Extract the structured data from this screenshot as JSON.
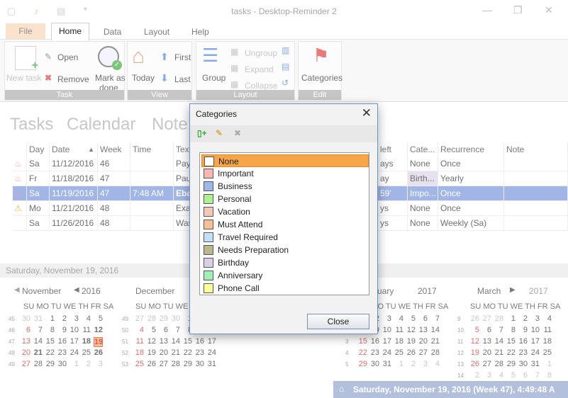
{
  "window": {
    "title": "tasks - Desktop-Reminder 2"
  },
  "menu": {
    "file": "File",
    "home": "Home",
    "data": "Data",
    "layout": "Layout",
    "help": "Help"
  },
  "ribbon": {
    "task": {
      "label": "Task",
      "new_task": "New task",
      "open": "Open",
      "remove": "Remove",
      "mark_done_1": "Mark as",
      "mark_done_2": "done"
    },
    "view": {
      "label": "View",
      "today": "Today",
      "first": "First",
      "last": "Last"
    },
    "layout": {
      "label": "Layout",
      "group": "Group",
      "ungroup": "Ungroup",
      "expand": "Expand",
      "collapse": "Collapse"
    },
    "edit": {
      "label": "Edit",
      "categories": "Categories"
    }
  },
  "views": {
    "tasks": "Tasks",
    "calendar": "Calendar",
    "notes": "Note"
  },
  "grid": {
    "headers": {
      "day": "Day",
      "date": "Date",
      "week": "Week",
      "time": "Time",
      "text": "Tex",
      "left": "left",
      "category": "Cate...",
      "recurrence": "Recurrence",
      "note": "Note"
    },
    "rows": [
      {
        "day": "Sa",
        "date": "11/12/2016",
        "week": "46",
        "time": "",
        "text": "Pay",
        "left": "ays",
        "category": "None",
        "recurrence": "Once"
      },
      {
        "day": "Fr",
        "date": "11/18/2016",
        "week": "47",
        "time": "",
        "text": "Pau",
        "left": "ay",
        "category": "Birth...",
        "recurrence": "Yearly"
      },
      {
        "day": "Sa",
        "date": "11/19/2016",
        "week": "47",
        "time": "7:48 AM",
        "text": "Eba",
        "left": "59'",
        "category": "Impo...",
        "recurrence": "Once"
      },
      {
        "day": "Mo",
        "date": "11/21/2016",
        "week": "48",
        "time": "",
        "text": "Exa",
        "left": "ys",
        "category": "None",
        "recurrence": "Once"
      },
      {
        "day": "Sa",
        "date": "11/26/2016",
        "week": "48",
        "time": "",
        "text": "Was",
        "left": "ys",
        "category": "None",
        "recurrence": "Weekly (Sa)"
      }
    ]
  },
  "calendar": {
    "header": "Saturday, November 19, 2016",
    "nov_month": "November",
    "nov_year": "2016",
    "dec_month": "December",
    "jan_month": "uary",
    "jan_year": "2017",
    "mar_month": "March",
    "mar_year": "2017",
    "dow": "SU MO TU WE TH FR SA"
  },
  "status": {
    "text": "Saturday, November 19, 2016 (Week 47), 4:49:48 A"
  },
  "dialog": {
    "title": "Categories",
    "close_button": "Close",
    "categories": [
      {
        "name": "None",
        "color": "#ffffff"
      },
      {
        "name": "Important",
        "color": "#f7b7b7"
      },
      {
        "name": "Business",
        "color": "#9db8e8"
      },
      {
        "name": "Personal",
        "color": "#aef08f"
      },
      {
        "name": "Vacation",
        "color": "#f6c8b8"
      },
      {
        "name": "Must Attend",
        "color": "#f7bf95"
      },
      {
        "name": "Travel Required",
        "color": "#bfe0f7"
      },
      {
        "name": "Needs Preparation",
        "color": "#b9b58c"
      },
      {
        "name": "Birthday",
        "color": "#d9cfe6"
      },
      {
        "name": "Anniversary",
        "color": "#9ff0b7"
      },
      {
        "name": "Phone Call",
        "color": "#ffff99"
      }
    ]
  }
}
